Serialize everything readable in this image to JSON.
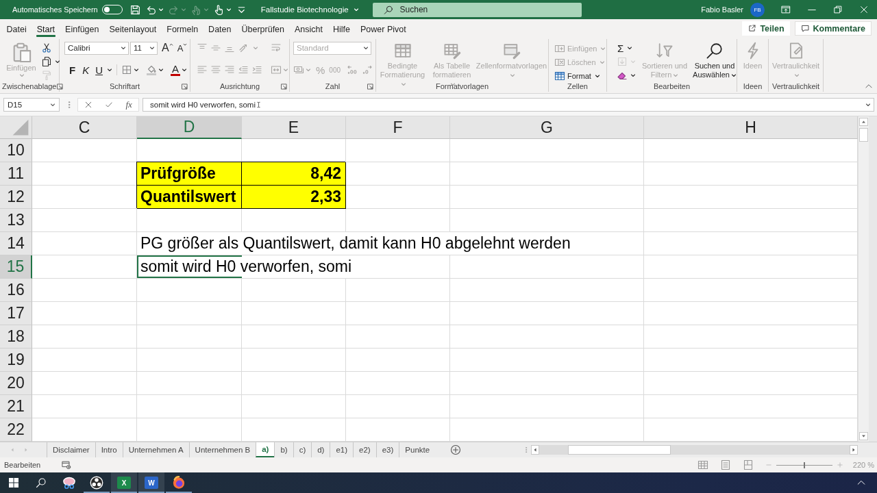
{
  "title_bar": {
    "autosave_label": "Automatisches Speichern",
    "autosave_on": false,
    "quick_access": [
      {
        "disabled": false,
        "dropdown": false
      },
      {
        "disabled": false,
        "dropdown": true
      },
      {
        "disabled": true,
        "dropdown": true
      },
      {
        "disabled": true,
        "dropdown": true
      },
      {
        "disabled": false,
        "dropdown": true
      },
      {
        "disabled": false,
        "dropdown": false
      }
    ],
    "document_title": "Fallstudie Biotechnologie",
    "search_placeholder": "Suchen",
    "user_name": "Fabio Basler",
    "user_initials": "FB"
  },
  "menu_tabs": [
    {
      "label": "Datei",
      "selected": false
    },
    {
      "label": "Start",
      "selected": true
    },
    {
      "label": "Einfügen",
      "selected": false
    },
    {
      "label": "Seitenlayout",
      "selected": false
    },
    {
      "label": "Formeln",
      "selected": false
    },
    {
      "label": "Daten",
      "selected": false
    },
    {
      "label": "Überprüfen",
      "selected": false
    },
    {
      "label": "Ansicht",
      "selected": false
    },
    {
      "label": "Hilfe",
      "selected": false
    },
    {
      "label": "Power Pivot",
      "selected": false
    }
  ],
  "share_button": "Teilen",
  "comments_button": "Kommentare",
  "ribbon": {
    "groups": [
      {
        "kind": "clipboard",
        "label": "Zwischenablage",
        "launcher": true,
        "buttons": [
          {
            "label": "Einfügen",
            "disabled": true,
            "dropdown": true
          }
        ],
        "tools": [
          {
            "disabled": false,
            "dropdown": false
          },
          {
            "disabled": false,
            "dropdown": true
          },
          {
            "disabled": true,
            "dropdown": false
          }
        ]
      },
      {
        "kind": "font",
        "label": "Schriftart",
        "launcher": true,
        "font_name": "Calibri",
        "font_size": "11",
        "grow_label": "A",
        "shrink_label": "A",
        "bold_label": "F",
        "italic_label": "K",
        "underline_label": "U",
        "font_color_label": "A"
      },
      {
        "kind": "alignment",
        "label": "Ausrichtung",
        "launcher": true,
        "disabled": true
      },
      {
        "kind": "number",
        "label": "Zahl",
        "launcher": true,
        "disabled": true,
        "number_format": "Standard",
        "percent_label": "%",
        "thousands_label": "000"
      },
      {
        "kind": "styles",
        "label": "Formatvorlagen",
        "launcher": false,
        "buttons": [
          {
            "label": "Bedingte Formatierung",
            "disabled": true,
            "dropdown": true
          },
          {
            "label": "Als Tabelle formatieren",
            "disabled": true,
            "dropdown": true
          },
          {
            "label": "Zellenformatvorlagen",
            "disabled": true,
            "dropdown": true
          }
        ]
      },
      {
        "kind": "cells",
        "label": "Zellen",
        "launcher": false,
        "buttons": [
          {
            "label": "Einfügen",
            "disabled": true,
            "dropdown": true
          },
          {
            "label": "Löschen",
            "disabled": true,
            "dropdown": true
          },
          {
            "label": "Format",
            "disabled": false,
            "dropdown": true
          }
        ]
      },
      {
        "kind": "editing",
        "label": "Bearbeiten",
        "launcher": false,
        "tools": [
          {
            "label": "Σ",
            "disabled": false,
            "dropdown": true
          },
          {
            "disabled": true,
            "dropdown": true
          },
          {
            "disabled": false,
            "dropdown": true
          }
        ],
        "buttons": [
          {
            "label": "Sortieren und Filtern",
            "disabled": true,
            "dropdown": true
          },
          {
            "label": "Suchen und Auswählen",
            "disabled": false,
            "dropdown": true
          }
        ]
      },
      {
        "kind": "ideas",
        "label": "Ideen",
        "launcher": false,
        "buttons": [
          {
            "label": "Ideen",
            "disabled": true,
            "dropdown": false
          }
        ]
      },
      {
        "kind": "sensitivity",
        "label": "Vertraulichkeit",
        "launcher": false,
        "buttons": [
          {
            "label": "Vertraulichkeit",
            "disabled": true,
            "dropdown": true
          }
        ]
      }
    ]
  },
  "formula_bar": {
    "name_box": "D15",
    "fx_label": "fx",
    "formula": "somit wird H0 verworfen, somi"
  },
  "sheet": {
    "columns": [
      {
        "label": "C",
        "selected": false
      },
      {
        "label": "D",
        "selected": true
      },
      {
        "label": "E",
        "selected": false
      },
      {
        "label": "F",
        "selected": false
      },
      {
        "label": "G",
        "selected": false
      },
      {
        "label": "H",
        "selected": false
      }
    ],
    "rows": [
      {
        "number": "10",
        "selected": false
      },
      {
        "number": "11",
        "selected": false,
        "cells": [
          {
            "highlighted": false
          },
          {
            "text": "Prüfgröße",
            "kind": "text",
            "bold": true,
            "highlighted": true
          },
          {
            "text": "8,42",
            "kind": "number",
            "bold": true,
            "highlighted": true
          }
        ]
      },
      {
        "number": "12",
        "selected": false,
        "cells": [
          {
            "highlighted": false
          },
          {
            "text": "Quantilswert",
            "kind": "text",
            "bold": true,
            "highlighted": true
          },
          {
            "text": "2,33",
            "kind": "number",
            "bold": true,
            "highlighted": true
          }
        ]
      },
      {
        "number": "13",
        "selected": false
      },
      {
        "number": "14",
        "selected": false,
        "cells": [
          {
            "highlighted": false
          },
          {
            "text": "PG größer als Quantilswert, damit kann H0 abgelehnt werden",
            "kind": "text",
            "bold": false,
            "highlighted": false
          }
        ]
      },
      {
        "number": "15",
        "selected": true,
        "cells": [
          {
            "highlighted": false
          },
          {
            "text": "somit wird H0 verworfen, somi",
            "kind": "text",
            "bold": false,
            "highlighted": false
          }
        ]
      },
      {
        "number": "16",
        "selected": false
      },
      {
        "number": "17",
        "selected": false
      },
      {
        "number": "18",
        "selected": false
      },
      {
        "number": "19",
        "selected": false
      },
      {
        "number": "20",
        "selected": false
      },
      {
        "number": "21",
        "selected": false
      },
      {
        "number": "22",
        "selected": false
      }
    ]
  },
  "sheet_tabs": [
    {
      "label": "Disclaimer",
      "selected": false
    },
    {
      "label": "Intro",
      "selected": false
    },
    {
      "label": "Unternehmen A",
      "selected": false
    },
    {
      "label": "Unternehmen B",
      "selected": false
    },
    {
      "label": "a)",
      "selected": true
    },
    {
      "label": "b)",
      "selected": false
    },
    {
      "label": "c)",
      "selected": false
    },
    {
      "label": "d)",
      "selected": false
    },
    {
      "label": "e1)",
      "selected": false
    },
    {
      "label": "e2)",
      "selected": false
    },
    {
      "label": "e3)",
      "selected": false
    },
    {
      "label": "Punkte",
      "selected": false
    }
  ],
  "status_bar": {
    "mode": "Bearbeiten",
    "zoom_slider": {
      "level": 0.5
    },
    "zoom_label": "220 %"
  },
  "taskbar": {
    "apps": [
      {
        "running": false,
        "highlighted": false
      },
      {
        "running": true,
        "highlighted": false
      },
      {
        "letter": "X",
        "running": true,
        "highlighted": true
      },
      {
        "letter": "W",
        "running": true,
        "highlighted": true
      },
      {
        "running": true,
        "highlighted": false
      }
    ]
  }
}
